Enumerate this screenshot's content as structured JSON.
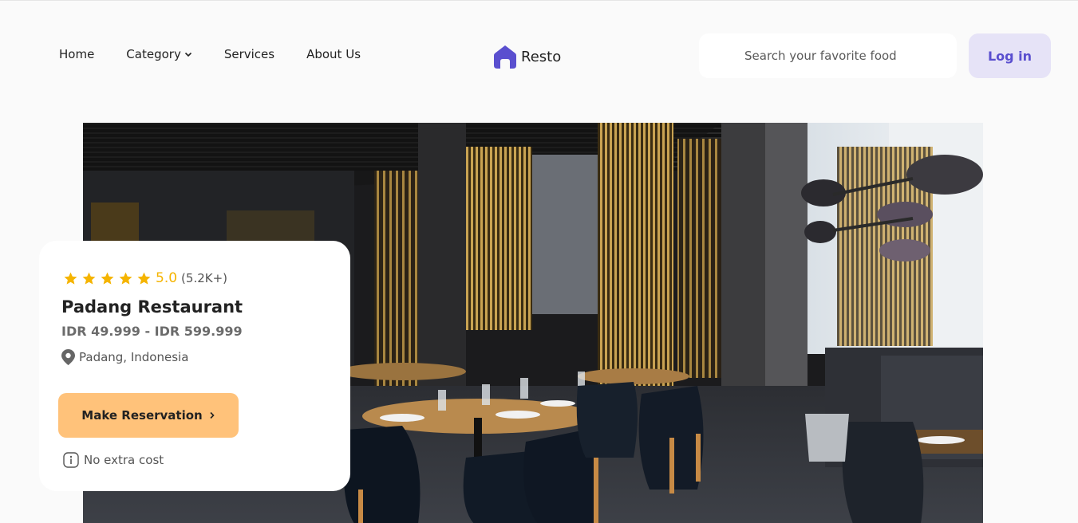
{
  "nav": {
    "home": "Home",
    "category": "Category",
    "services": "Services",
    "about": "About Us"
  },
  "brand": {
    "name": "Resto",
    "accent": "#5a4fcf"
  },
  "search": {
    "placeholder": "Search your favorite food"
  },
  "login": {
    "label": "Log in"
  },
  "card": {
    "stars": 5,
    "rating": "5.0",
    "rating_count": "(5.2K+)",
    "name": "Padang Restaurant",
    "price": "IDR 49.999 - IDR 599.999",
    "location": "Padang, Indonesia",
    "cta": "Make Reservation",
    "cta_icon": "chevron-right-icon",
    "note": "No extra cost",
    "star_color": "#f5b400",
    "cta_color": "#ffc27a"
  }
}
